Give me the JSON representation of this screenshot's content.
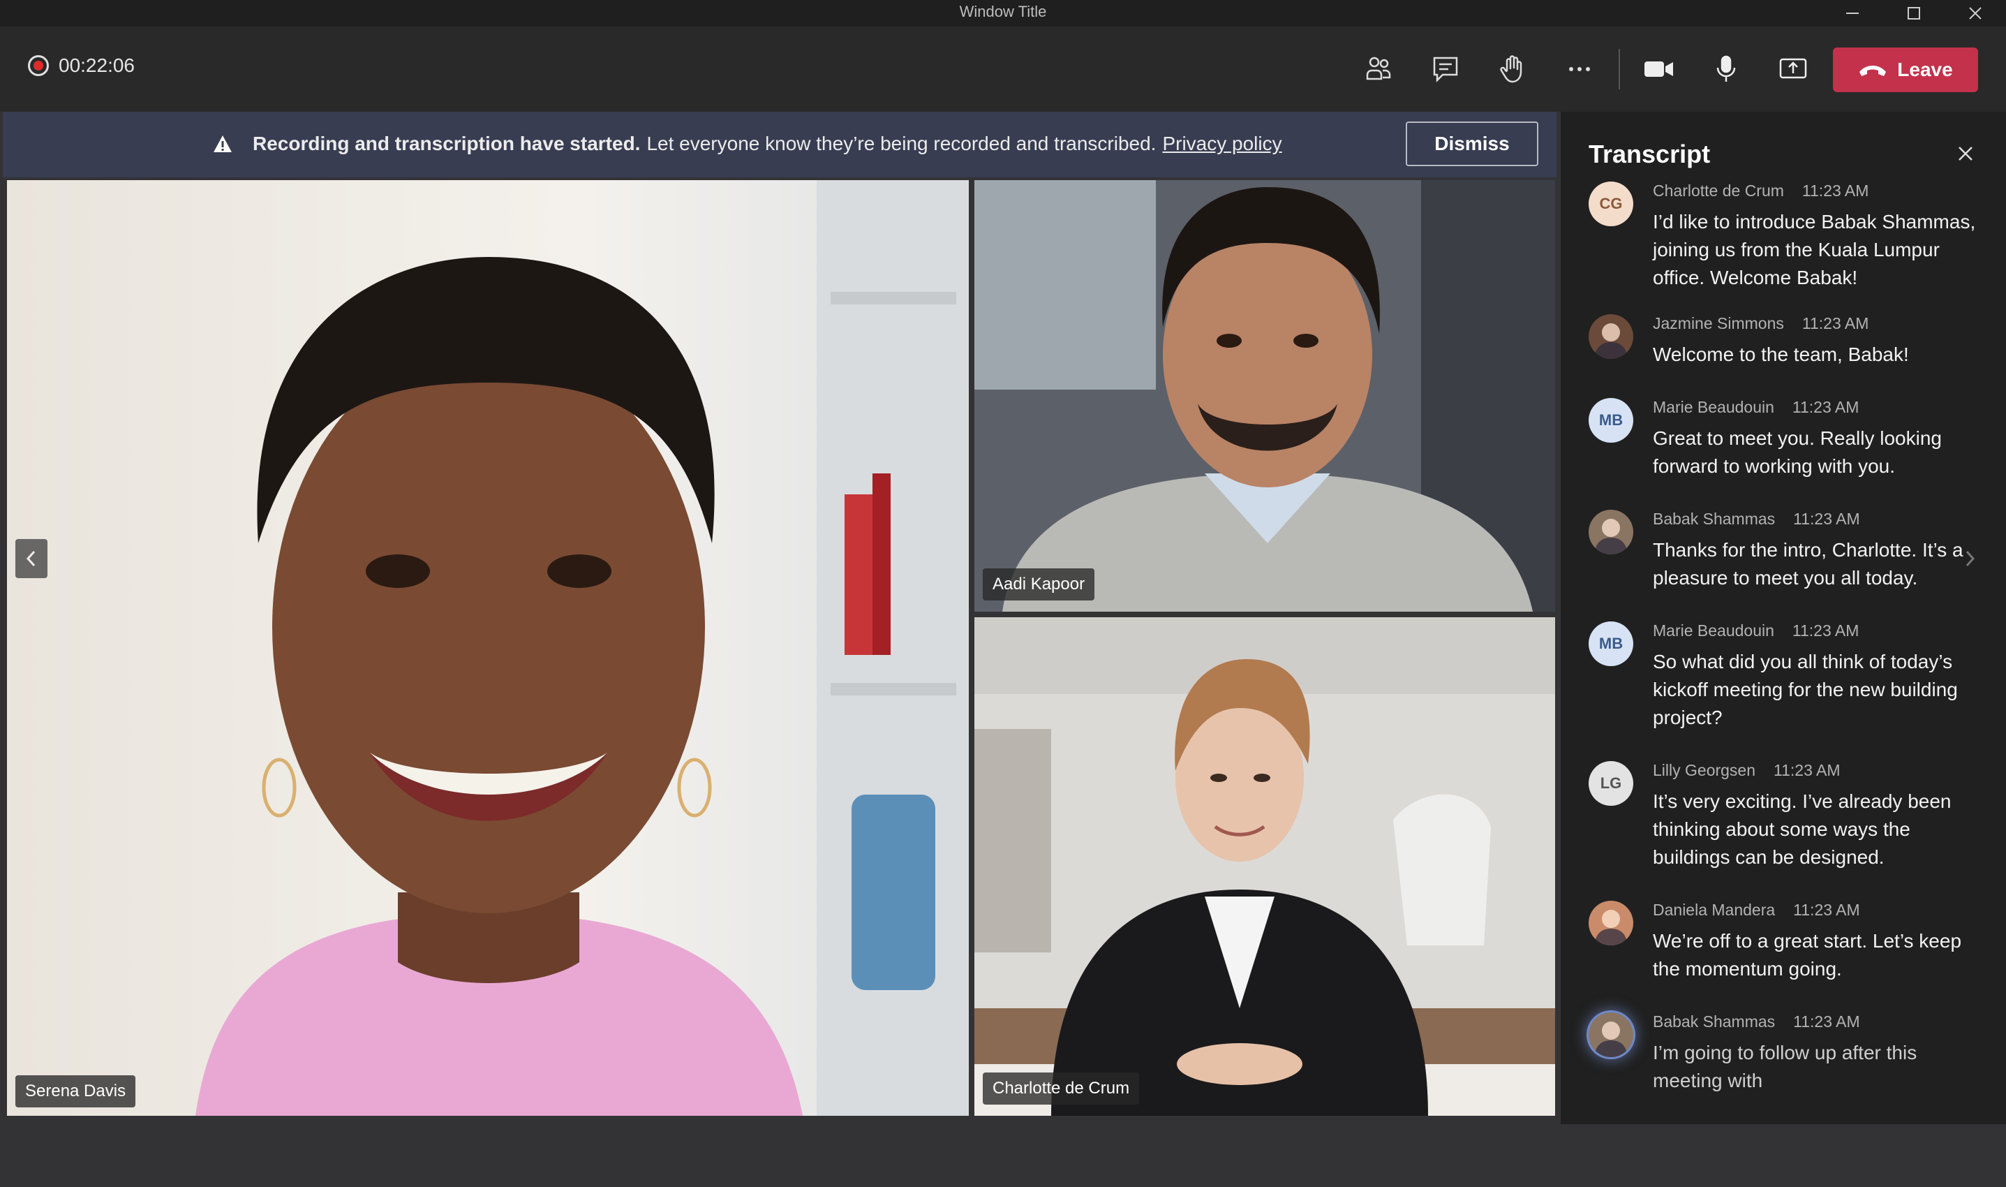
{
  "window": {
    "title": "Window Title"
  },
  "toolbar": {
    "timer": "00:22:06",
    "leave_label": "Leave",
    "icons": [
      "people-icon",
      "chat-icon",
      "raise-hand-icon",
      "more-icon",
      "camera-icon",
      "microphone-icon",
      "share-screen-icon",
      "phone-hangup-icon"
    ]
  },
  "banner": {
    "bold": "Recording and transcription have started.",
    "text": "Let everyone know they’re being recorded and transcribed.",
    "link": "Privacy policy",
    "dismiss_label": "Dismiss"
  },
  "videos": {
    "serena": "Serena Davis",
    "aadi": "Aadi Kapoor",
    "charlotte": "Charlotte de Crum"
  },
  "transcript": {
    "title": "Transcript",
    "entries": [
      {
        "initials": "CG",
        "name": "Charlotte de Crum",
        "time": "11:23 AM",
        "text": "I’d like to introduce Babak Shammas, joining us from the Kuala Lumpur office. Welcome Babak!",
        "avatar_color": "#f4dccb",
        "initials_color": "#8a5a3c"
      },
      {
        "initials": "",
        "name": "Jazmine Simmons",
        "time": "11:23 AM",
        "text": "Welcome to the team, Babak!",
        "avatar_color": "#6b4a3a"
      },
      {
        "initials": "MB",
        "name": "Marie Beaudouin",
        "time": "11:23 AM",
        "text": "Great to meet you. Really looking forward to working with you.",
        "avatar_color": "#d7e3f4",
        "initials_color": "#3b5b8c"
      },
      {
        "initials": "",
        "name": "Babak Shammas",
        "time": "11:23 AM",
        "text": "Thanks for the intro, Charlotte. It’s a pleasure to meet you all today.",
        "avatar_color": "#8a7462"
      },
      {
        "initials": "MB",
        "name": "Marie Beaudouin",
        "time": "11:23 AM",
        "text": "So what did you all think of today’s kickoff meeting for the new building project?",
        "avatar_color": "#d7e3f4",
        "initials_color": "#3b5b8c"
      },
      {
        "initials": "LG",
        "name": "Lilly Georgsen",
        "time": "11:23 AM",
        "text": "It’s very exciting. I’ve already been thinking about some ways the buildings can be designed.",
        "avatar_color": "#e3e3e3",
        "initials_color": "#555555"
      },
      {
        "initials": "",
        "name": "Daniela Mandera",
        "time": "11:23 AM",
        "text": "We’re off to a great start. Let’s keep the momentum going.",
        "avatar_color": "#c98b6a"
      },
      {
        "initials": "",
        "name": "Babak Shammas",
        "time": "11:23 AM",
        "text": "I’m going to follow up after this meeting with",
        "avatar_color": "#8a7462"
      }
    ]
  }
}
